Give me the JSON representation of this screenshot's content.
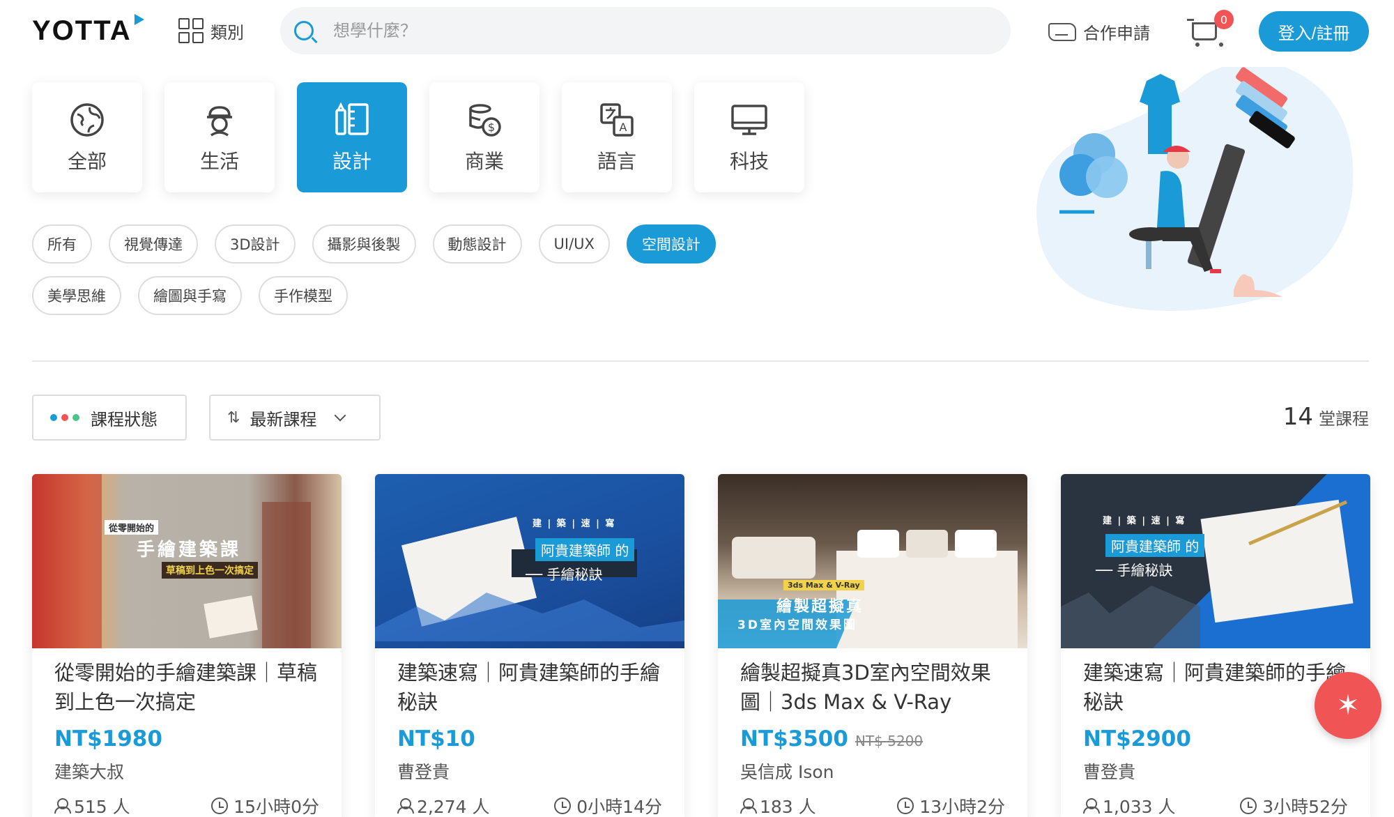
{
  "header": {
    "logo_text": "YOTTA",
    "category_label": "類別",
    "search_placeholder": "想學什麼？",
    "partner_label": "合作申請",
    "cart_count": "0",
    "login_label": "登入/註冊"
  },
  "categories": [
    {
      "label": "全部",
      "icon": "globe-icon",
      "active": false
    },
    {
      "label": "生活",
      "icon": "chef-icon",
      "active": false
    },
    {
      "label": "設計",
      "icon": "design-tools-icon",
      "active": true
    },
    {
      "label": "商業",
      "icon": "coins-icon",
      "active": false
    },
    {
      "label": "語言",
      "icon": "translate-icon",
      "active": false
    },
    {
      "label": "科技",
      "icon": "monitor-icon",
      "active": false
    }
  ],
  "tags": [
    {
      "label": "所有",
      "active": false
    },
    {
      "label": "視覺傳達",
      "active": false
    },
    {
      "label": "3D設計",
      "active": false
    },
    {
      "label": "攝影與後製",
      "active": false
    },
    {
      "label": "動態設計",
      "active": false
    },
    {
      "label": "UI/UX",
      "active": false
    },
    {
      "label": "空間設計",
      "active": true
    },
    {
      "label": "美學思維",
      "active": false
    },
    {
      "label": "繪圖與手寫",
      "active": false
    },
    {
      "label": "手作模型",
      "active": false
    }
  ],
  "filters": {
    "status_label": "課程狀態",
    "sort_label": "最新課程"
  },
  "count": {
    "number": "14",
    "unit": "堂課程"
  },
  "courses": [
    {
      "title": "從零開始的手繪建築課｜草稿到上色一次搞定",
      "price": "NT$1980",
      "old_price": "",
      "teacher": "建築大叔",
      "students": "515 人",
      "duration": "15小時0分",
      "thumb_small": "從零開始的",
      "thumb_main": "手繪建築課",
      "thumb_sub": "草稿到上色一次搞定"
    },
    {
      "title": "建築速寫｜阿貴建築師的手繪秘訣",
      "price": "NT$10",
      "old_price": "",
      "teacher": "曹登貴",
      "students": "2,274 人",
      "duration": "0小時14分",
      "thumb_small": "建 | 築 | 速 | 寫",
      "thumb_main": "阿貴建築師 的",
      "thumb_sub": "── 手繪秘訣"
    },
    {
      "title": "繪製超擬真3D室內空間效果圖｜3ds Max & V-Ray",
      "price": "NT$3500",
      "old_price": "NT$ 5200",
      "teacher": "吳信成 Ison",
      "students": "183 人",
      "duration": "13小時2分",
      "thumb_small": "3ds Max & V-Ray",
      "thumb_main": "繪製超擬真",
      "thumb_sub": "3D室內空間效果圖"
    },
    {
      "title": "建築速寫｜阿貴建築師的手繪秘訣",
      "price": "NT$2900",
      "old_price": "",
      "teacher": "曹登貴",
      "students": "1,033 人",
      "duration": "3小時52分",
      "thumb_small": "建 | 築 | 速 | 寫",
      "thumb_main": "阿貴建築師 的",
      "thumb_sub": "── 手繪秘訣"
    }
  ],
  "colors": {
    "accent": "#1a9ad6",
    "badge": "#f05455",
    "status_dots": [
      "#1a9ad6",
      "#f05455",
      "#4cc38a"
    ]
  }
}
